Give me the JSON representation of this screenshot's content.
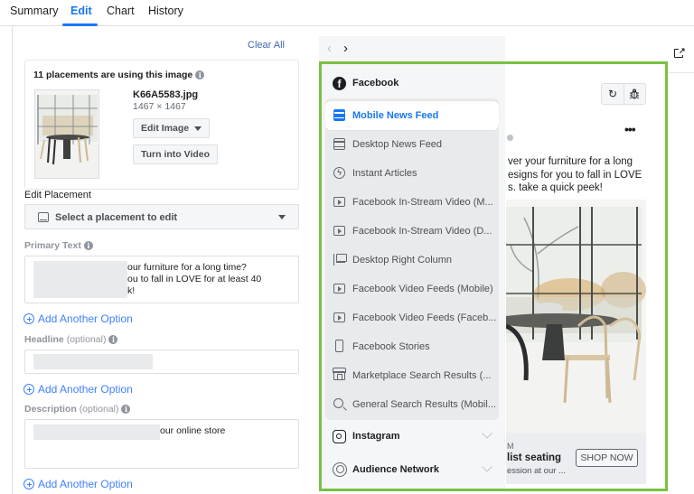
{
  "tabs": [
    {
      "label": "Summary",
      "active": false
    },
    {
      "label": "Edit",
      "active": true
    },
    {
      "label": "Chart",
      "active": false
    },
    {
      "label": "History",
      "active": false
    }
  ],
  "colors": {
    "accent": "#1877f2",
    "link": "#4080ff",
    "highlight_frame": "#7ac142"
  },
  "editor": {
    "clear_all": "Clear All",
    "image_card": {
      "title": "11 placements are using this image",
      "info_icon": "info-icon",
      "file_name": "K66A5583.jpg",
      "dimensions": "1467 × 1467",
      "edit_image_button": "Edit Image",
      "turn_into_video_button": "Turn into Video"
    },
    "edit_placement": {
      "label": "Edit Placement",
      "select_placeholder": "Select a placement to edit"
    },
    "primary_text": {
      "label": "Primary Text",
      "visible_lines": [
        "our furniture for a long time?",
        "ou to fall in LOVE for at least 40",
        "k!"
      ]
    },
    "headline": {
      "label": "Headline",
      "optional": "(optional)"
    },
    "description": {
      "label": "Description",
      "optional": "(optional)",
      "visible_text": "our online store"
    },
    "add_option_label": "Add Another Option"
  },
  "preview": {
    "nav_prev": "‹",
    "nav_next": "›",
    "open_external_icon": "open-external-icon",
    "menu": {
      "platforms": [
        {
          "name": "Facebook",
          "icon": "facebook-icon",
          "expanded": true
        },
        {
          "name": "Instagram",
          "icon": "instagram-icon",
          "expanded": false
        },
        {
          "name": "Audience Network",
          "icon": "audience-network-icon",
          "expanded": false
        }
      ],
      "facebook_items": [
        {
          "label": "Mobile News Feed",
          "icon": "feed",
          "selected": true
        },
        {
          "label": "Desktop News Feed",
          "icon": "feed",
          "selected": false
        },
        {
          "label": "Instant Articles",
          "icon": "bolt",
          "selected": false
        },
        {
          "label": "Facebook In-Stream Video (M...",
          "icon": "play",
          "selected": false
        },
        {
          "label": "Facebook In-Stream Video (D...",
          "icon": "play",
          "selected": false
        },
        {
          "label": "Desktop Right Column",
          "icon": "column",
          "selected": false
        },
        {
          "label": "Facebook Video Feeds (Mobile)",
          "icon": "play",
          "selected": false
        },
        {
          "label": "Facebook Video Feeds (Faceb...",
          "icon": "play",
          "selected": false
        },
        {
          "label": "Facebook Stories",
          "icon": "story",
          "selected": false
        },
        {
          "label": "Marketplace Search Results (...",
          "icon": "market",
          "selected": false
        },
        {
          "label": "General Search Results (Mobil...",
          "icon": "search",
          "selected": false
        }
      ]
    },
    "ad": {
      "more_label": "•••",
      "body_lines": [
        "ver your furniture for a long",
        "esigns for you to fall in LOVE",
        "s. take a quick peek!"
      ],
      "footer_small": "M",
      "footer_headline": "list seating",
      "footer_desc": "ession at our ...",
      "cta": "SHOP NOW"
    },
    "tools": {
      "refresh_icon": "↻",
      "bug_icon": "🐞"
    }
  }
}
